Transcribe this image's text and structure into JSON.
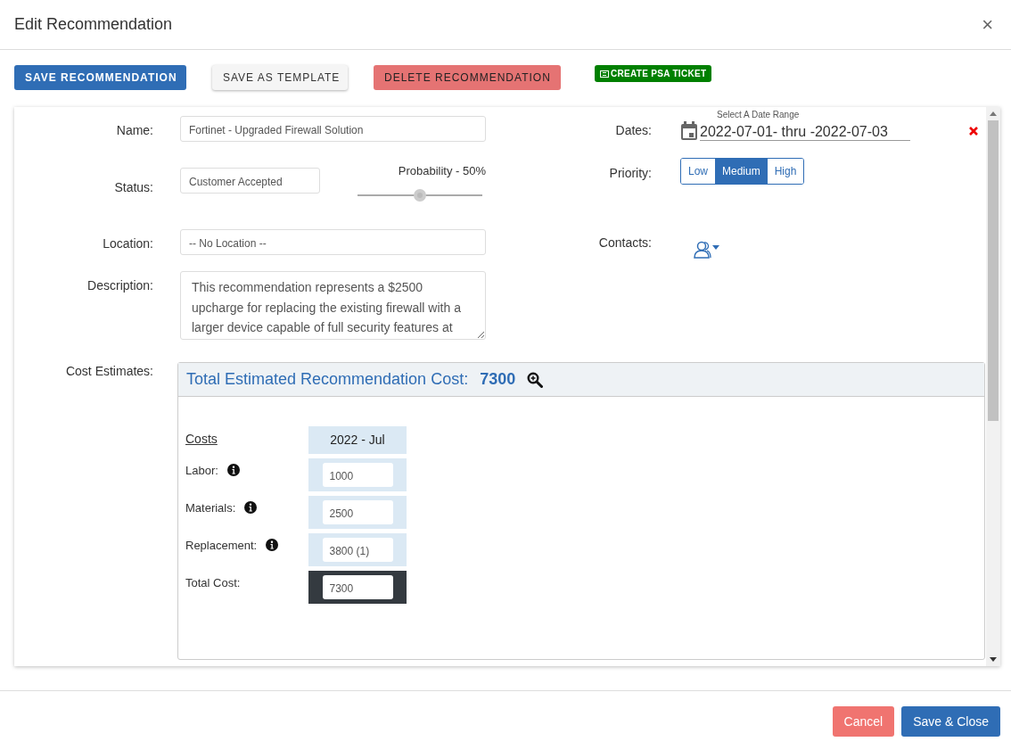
{
  "window": {
    "title": "Edit Recommendation",
    "close": "×"
  },
  "toolbar": [
    {
      "label": "SAVE RECOMMENDATION",
      "kind": "primary"
    },
    {
      "label": "SAVE AS TEMPLATE",
      "kind": "light"
    },
    {
      "label": "DELETE RECOMMENDATION",
      "kind": "danger"
    },
    {
      "label": "CREATE PSA TICKET",
      "kind": "ticket"
    }
  ],
  "form": {
    "name": {
      "label": "Name:",
      "value": "Fortinet - Upgraded Firewall Solution"
    },
    "dates": {
      "label": "Dates:",
      "hint": "Select A Date Range",
      "value": "2022-07-01- thru -2022-07-03"
    },
    "status": {
      "label": "Status:",
      "value": "Customer Accepted"
    },
    "probability": {
      "label": "Probability - 50%",
      "level": 0.5
    },
    "priority": {
      "label": "Priority:",
      "options": [
        {
          "label": "Low",
          "selected": false
        },
        {
          "label": "Medium",
          "selected": true
        },
        {
          "label": "High",
          "selected": false
        }
      ]
    },
    "location": {
      "label": "Location:",
      "value": "-- No Location --"
    },
    "contacts": {
      "label": "Contacts:"
    },
    "description": {
      "label": "Description:",
      "value": "This recommendation represents a $2500 upcharge for replacing the existing firewall with a larger device capable of full security features at"
    },
    "cost_estimates": {
      "label": "Cost Estimates:",
      "total_label": "Total Estimated Recommendation Cost:",
      "total": "7300",
      "table": {
        "heading": "Costs",
        "column": "2022 - Jul",
        "rows": [
          {
            "label": "Labor:",
            "value": "1000",
            "kind": "item"
          },
          {
            "label": "Materials:",
            "value": "2500",
            "kind": "item"
          },
          {
            "label": "Replacement:",
            "value": "3800 (1)",
            "kind": "item"
          },
          {
            "label": "Total Cost:",
            "value": "7300",
            "kind": "total"
          }
        ]
      }
    }
  },
  "footer": [
    {
      "label": "Cancel",
      "kind": "cancel"
    },
    {
      "label": "Save & Close",
      "kind": "primary"
    }
  ]
}
